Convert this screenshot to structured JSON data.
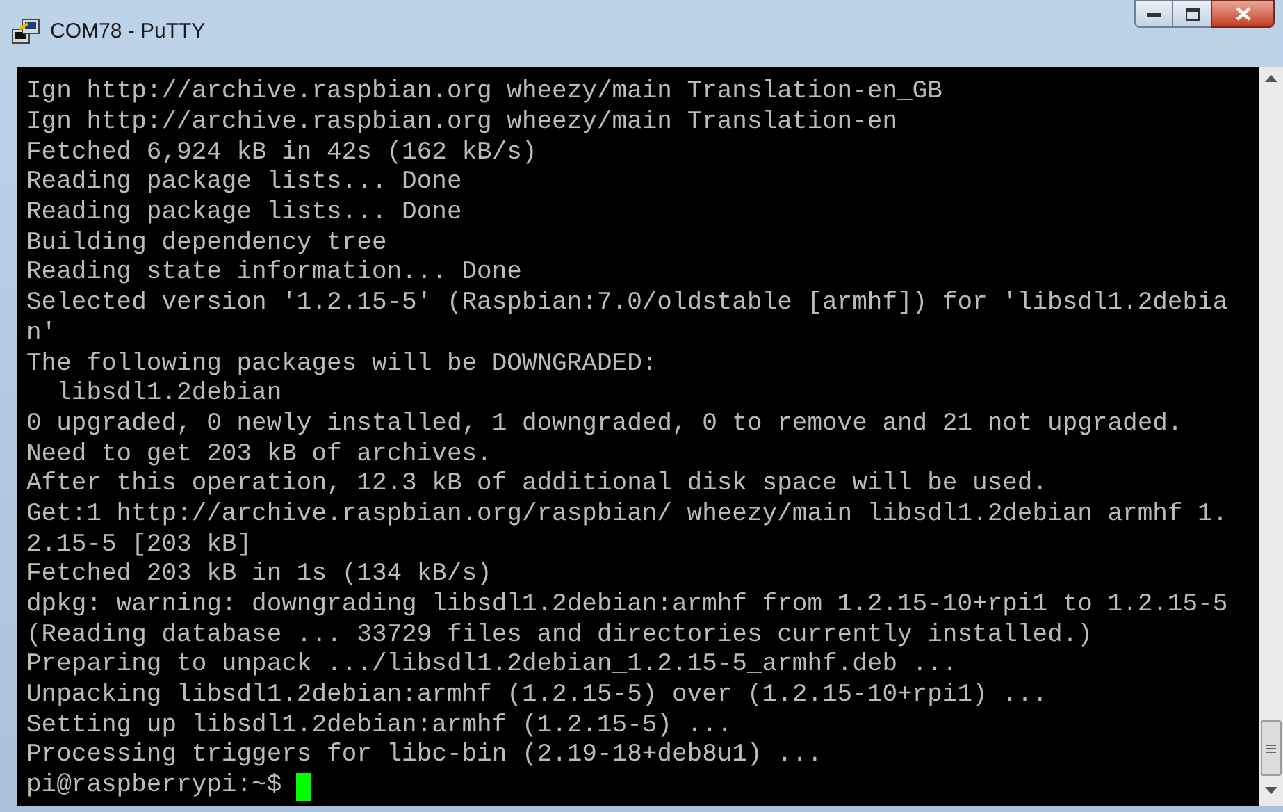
{
  "window": {
    "title": "COM78 - PuTTY"
  },
  "terminal": {
    "cursor_visible": true,
    "lines": [
      "Ign http://archive.raspbian.org wheezy/main Translation-en_GB",
      "Ign http://archive.raspbian.org wheezy/main Translation-en",
      "Fetched 6,924 kB in 42s (162 kB/s)",
      "Reading package lists... Done",
      "Reading package lists... Done",
      "Building dependency tree",
      "Reading state information... Done",
      "Selected version '1.2.15-5' (Raspbian:7.0/oldstable [armhf]) for 'libsdl1.2debia",
      "n'",
      "The following packages will be DOWNGRADED:",
      "  libsdl1.2debian",
      "0 upgraded, 0 newly installed, 1 downgraded, 0 to remove and 21 not upgraded.",
      "Need to get 203 kB of archives.",
      "After this operation, 12.3 kB of additional disk space will be used.",
      "Get:1 http://archive.raspbian.org/raspbian/ wheezy/main libsdl1.2debian armhf 1.",
      "2.15-5 [203 kB]",
      "Fetched 203 kB in 1s (134 kB/s)",
      "dpkg: warning: downgrading libsdl1.2debian:armhf from 1.2.15-10+rpi1 to 1.2.15-5",
      "(Reading database ... 33729 files and directories currently installed.)",
      "Preparing to unpack .../libsdl1.2debian_1.2.15-5_armhf.deb ...",
      "Unpacking libsdl1.2debian:armhf (1.2.15-5) over (1.2.15-10+rpi1) ...",
      "Setting up libsdl1.2debian:armhf (1.2.15-5) ...",
      "Processing triggers for libc-bin (2.19-18+deb8u1) ...",
      "pi@raspberrypi:~$ "
    ]
  }
}
